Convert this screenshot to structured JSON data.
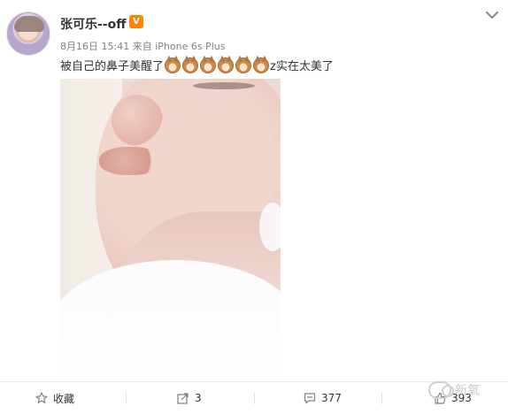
{
  "post": {
    "author": "张可乐--off",
    "vip_label": "V",
    "date": "8月16日 15:41",
    "source_prefix": "来自",
    "source": "iPhone 6s Plus",
    "text_before": "被自己的鼻子美醒了",
    "emoji": "dog-emoji",
    "emoji_count": 6,
    "text_after": "z实在太美了"
  },
  "actions": {
    "favorite_label": "收藏",
    "repost_count": "3",
    "comment_count": "377",
    "like_count": "393"
  },
  "watermark": {
    "text": "新氧"
  },
  "colors": {
    "text_dark": "#333333",
    "text_meta": "#808080",
    "vip": "#ff8200",
    "divider": "#ececec"
  }
}
